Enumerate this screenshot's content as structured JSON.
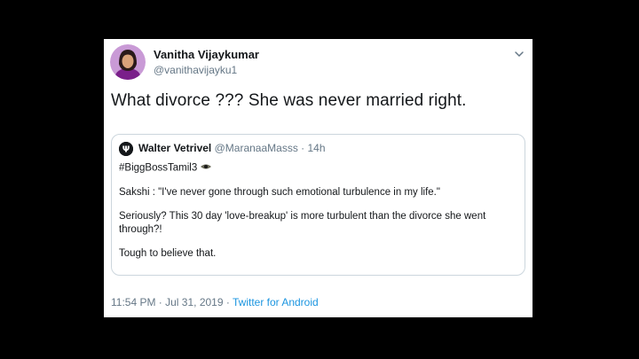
{
  "tweet": {
    "author_name": "Vanitha Vijaykumar",
    "author_handle": "@vanithavijayku1",
    "text": "What divorce ??? She was never married right.",
    "timestamp": "11:54 PM · Jul 31, 2019",
    "separator": " · ",
    "source": "Twitter for Android"
  },
  "quoted": {
    "author_name": "Walter Vetrivel",
    "author_handle": "@MaranaaMasss",
    "age": "· 14h",
    "hashtag": "#BiggBossTamil3",
    "paragraphs": [
      "Sakshi : \"I've never gone through such emotional turbulence in my life.\"",
      "Seriously? This 30 day 'love-breakup' is more turbulent than the divorce she went through?!",
      "Tough to believe that."
    ]
  },
  "icons": {
    "avatar": "profile-photo-avatar",
    "menu": "chevron-down-icon",
    "quoted_avatar": "quoted-profile-avatar",
    "hashtag_emoji": "eye-emoji-icon"
  },
  "colors": {
    "link": "#1b95e0",
    "text": "#14171a",
    "secondary": "#657786",
    "border": "#ccd6dd"
  }
}
